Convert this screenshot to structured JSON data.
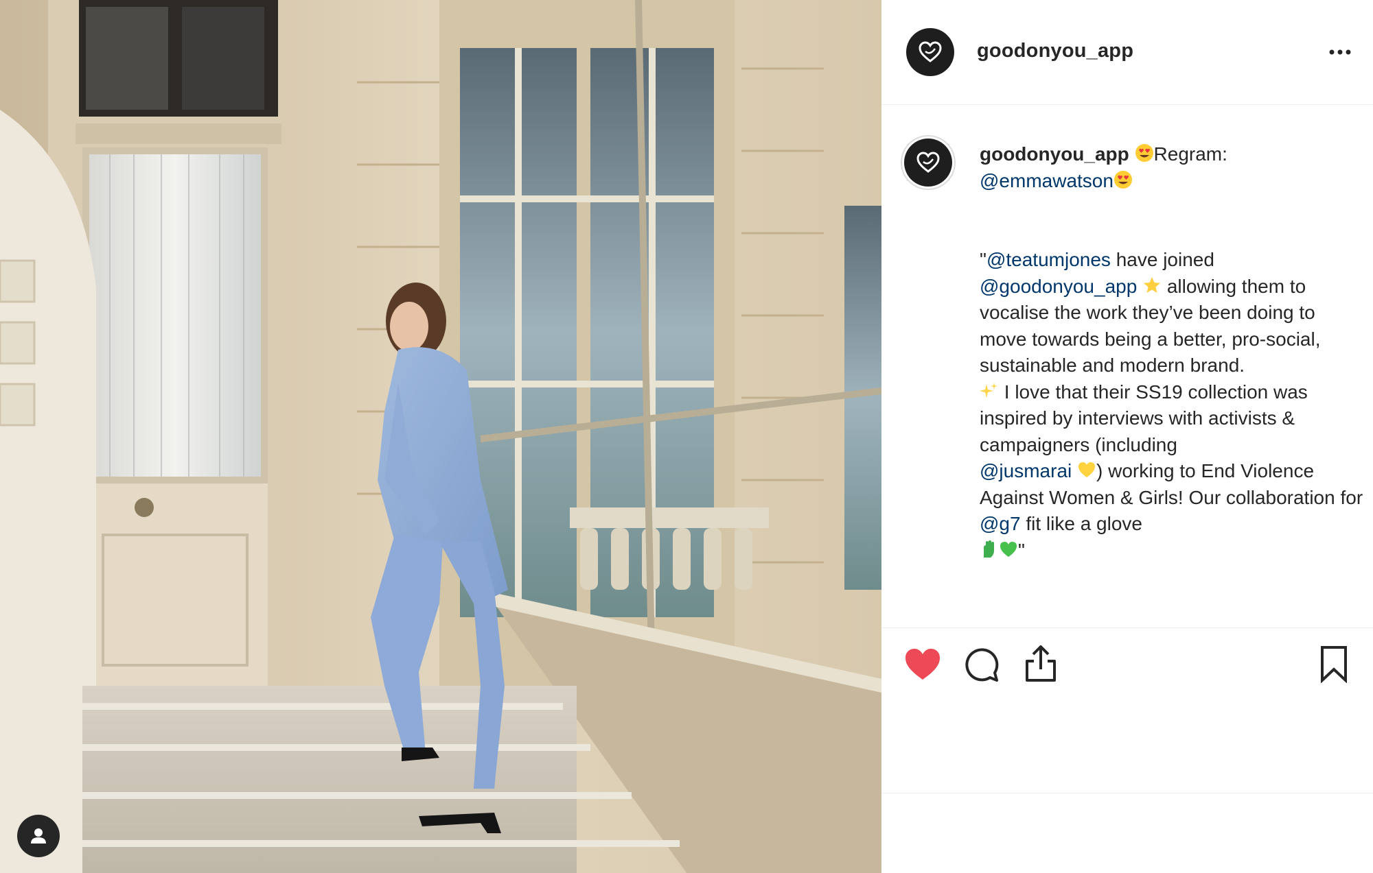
{
  "post": {
    "username": "goodonyou_app",
    "more_icon": "more-horizontal-icon",
    "avatar_icon": "heart-outline-logo-icon",
    "tag_icon": "user-tag-icon"
  },
  "caption": {
    "username": "goodonyou_app",
    "line1_text": "Regram:",
    "mention_emma": "@emmawatson",
    "quote_open": "\"",
    "mention_teatum": "@teatumjones",
    "text_joined": " have joined",
    "mention_goy": "@goodonyou_app",
    "text_allowing": " allowing them to vocalise the work they’ve been doing to move towards being a better, pro-social, sustainable and modern brand.",
    "text_love": " I love that their SS19 collection was inspired by interviews with activists & campaigners (including",
    "mention_jusmarai": "@jusmarai",
    "text_working": ") working to End Violence Against Women & Girls! Our collaboration for",
    "mention_g7": "@g7",
    "text_fit": " fit like a glove",
    "quote_close": "\""
  },
  "actions": {
    "like_icon": "heart-filled-icon",
    "comment_icon": "comment-bubble-icon",
    "share_icon": "share-upload-icon",
    "save_icon": "bookmark-icon",
    "like_color": "#ed4956"
  },
  "colors": {
    "mention": "#00376b",
    "text": "#262626",
    "divider": "#efefef"
  }
}
